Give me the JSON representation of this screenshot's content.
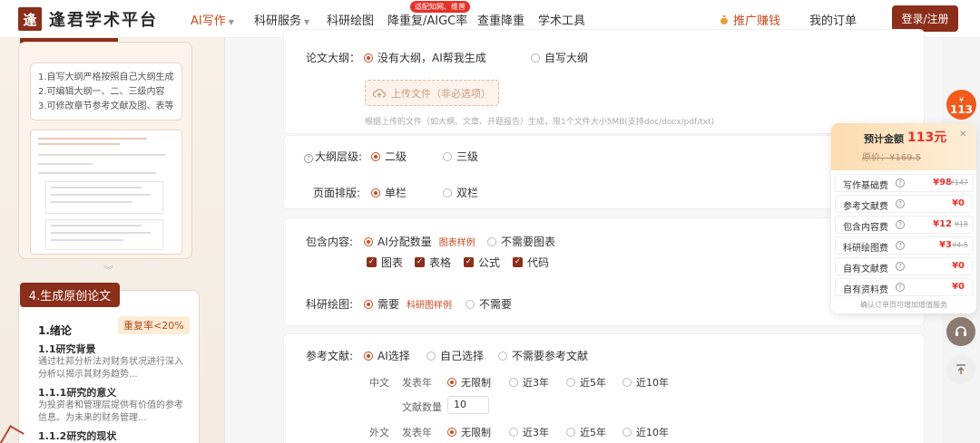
{
  "header": {
    "logo_mark": "逢",
    "logo_text": "逢君学术平台",
    "nav": [
      {
        "label": "AI写作",
        "active": true,
        "caret": true
      },
      {
        "label": "科研服务",
        "caret": true
      },
      {
        "label": "科研绘图"
      },
      {
        "label": "降重复/AIGC率"
      },
      {
        "label": "查重降重"
      },
      {
        "label": "学术工具"
      }
    ],
    "hot_badge": "适配知网、维普",
    "promo": "推广赚钱",
    "orders": "我的订单",
    "login": "登录/注册"
  },
  "left": {
    "steps": [
      "1.自写大纲严格按照自己大纲生成",
      "2.可编辑大纲一、二、三级内容",
      "3.可修改章节参考文献及图、表等"
    ],
    "step4_title": "4.生成原创论文",
    "dup_badge": "重复率<20%",
    "sample": {
      "h1": "1.绪论",
      "h2a": "1.1研究背景",
      "p1": "通过杜邦分析法对财务状况进行深入分析以揭示其财务趋势...",
      "h2b": "1.1.1研究的意义",
      "p2": "为投资者和管理层提供有价值的参考信息。为未来的财务管理...",
      "h2c": "1.1.2研究的现状"
    }
  },
  "form": {
    "outline": {
      "label": "论文大纲：",
      "opt1": "没有大纲，AI帮我生成",
      "opt2": "自写大纲",
      "upload": "上传文件（非必选项）",
      "hint": "根据上传的文件（如大纲、文章、开题报告）生成，限1个文件大小5MB(支持doc/docx/pdf/txt)"
    },
    "level": {
      "label": "大纲层级:",
      "opt1": "二级",
      "opt2": "三级"
    },
    "layout": {
      "label": "页面排版:",
      "opt1": "单栏",
      "opt2": "双栏"
    },
    "content": {
      "label": "包含内容:",
      "opt1": "AI分配数量",
      "sample": "图表样例",
      "opt2": "不需要图表",
      "checks": [
        "图表",
        "表格",
        "公式",
        "代码"
      ]
    },
    "drawing": {
      "label": "科研绘图:",
      "opt1": "需要",
      "sample": "科研图样例",
      "opt2": "不需要"
    },
    "refs": {
      "label": "参考文献:",
      "opt1": "AI选择",
      "opt2": "自己选择",
      "opt3": "不需要参考文献",
      "cn": "中文",
      "foreign": "外文",
      "year_label": "发表年",
      "years": [
        "无限制",
        "近3年",
        "近5年",
        "近10年"
      ],
      "count_label": "文献数量",
      "count_value": "10"
    }
  },
  "side": {
    "badge_symbol": "¥",
    "badge_value": "113"
  },
  "price": {
    "title": "预计金额",
    "total": "113元",
    "original": "原价：¥169.5",
    "items": [
      {
        "name": "写作基础费",
        "price": "¥98",
        "orig": "¥147"
      },
      {
        "name": "参考文献费",
        "price": "¥0",
        "orig": ""
      },
      {
        "name": "包含内容费",
        "price": "¥12",
        "orig": "¥18"
      },
      {
        "name": "科研绘图费",
        "price": "¥3",
        "orig": "¥4.5"
      },
      {
        "name": "自有文献费",
        "price": "¥0",
        "orig": ""
      },
      {
        "name": "自有资料费",
        "price": "¥0",
        "orig": ""
      }
    ],
    "note": "确认订单页可增加增值服务"
  },
  "colors": {
    "brand": "#8b2e1a",
    "accent": "#c64b22",
    "price_red": "#e4322a",
    "badge_orange": "#f25a1c"
  }
}
